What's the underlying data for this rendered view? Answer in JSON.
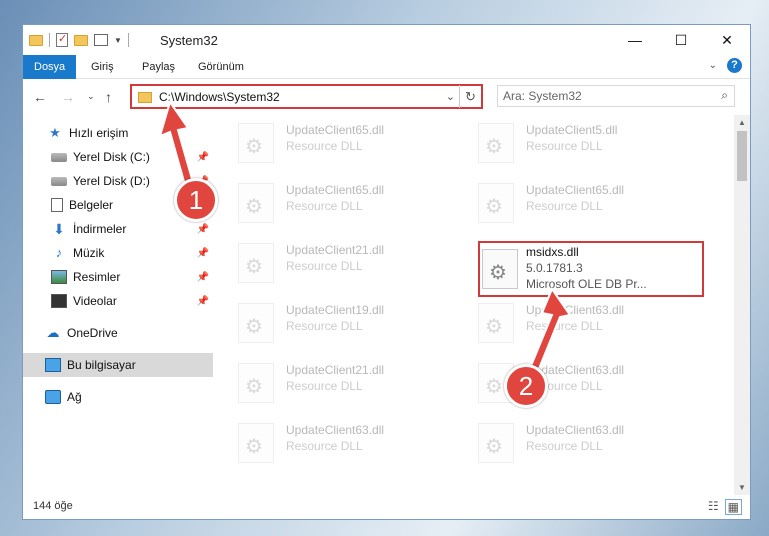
{
  "window": {
    "title": "System32"
  },
  "ribbon": {
    "tabs": [
      "Dosya",
      "Giriş",
      "Paylaş",
      "Görünüm"
    ]
  },
  "address": {
    "path": "C:\\Windows\\System32"
  },
  "search": {
    "placeholder": "Ara: System32"
  },
  "sidebar": {
    "items": [
      {
        "label": "Hızlı erişim",
        "icon": "star-icon"
      },
      {
        "label": "Yerel Disk (C:)",
        "icon": "drive-icon",
        "pinned": true
      },
      {
        "label": "Yerel Disk (D:)",
        "icon": "drive-icon",
        "pinned": true
      },
      {
        "label": "Belgeler",
        "icon": "document-icon",
        "pinned": true
      },
      {
        "label": "İndirmeler",
        "icon": "download-icon",
        "pinned": true
      },
      {
        "label": "Müzik",
        "icon": "music-icon",
        "pinned": true
      },
      {
        "label": "Resimler",
        "icon": "pictures-icon",
        "pinned": true
      },
      {
        "label": "Videolar",
        "icon": "video-icon",
        "pinned": true
      },
      {
        "label": "OneDrive",
        "icon": "cloud-icon"
      },
      {
        "label": "Bu bilgisayar",
        "icon": "computer-icon",
        "selected": true
      },
      {
        "label": "Ağ",
        "icon": "network-icon"
      }
    ]
  },
  "files": [
    {
      "name": "UpdateClient65.dll",
      "sub1": "Resource DLL",
      "sub2": ""
    },
    {
      "name": "UpdateClient5.dll",
      "sub1": "Resource DLL",
      "sub2": ""
    },
    {
      "name": "UpdateClient65.dll",
      "sub1": "Resource DLL",
      "sub2": ""
    },
    {
      "name": "UpdateClient65.dll",
      "sub1": "Resource DLL",
      "sub2": ""
    },
    {
      "name": "UpdateClient21.dll",
      "sub1": "Resource DLL",
      "sub2": ""
    },
    {
      "name": "msidxs.dll",
      "sub1": "5.0.1781.3",
      "sub2": "Microsoft OLE DB Pr..."
    },
    {
      "name": "UpdateClient19.dll",
      "sub1": "Resource DLL",
      "sub2": ""
    },
    {
      "name": "UpdateClient63.dll",
      "sub1": "Resource DLL",
      "sub2": ""
    },
    {
      "name": "UpdateClient21.dll",
      "sub1": "Resource DLL",
      "sub2": ""
    },
    {
      "name": "UpdateClient63.dll",
      "sub1": "Resource DLL",
      "sub2": ""
    },
    {
      "name": "UpdateClient63.dll",
      "sub1": "Resource DLL",
      "sub2": ""
    },
    {
      "name": "UpdateClient63.dll",
      "sub1": "Resource DLL",
      "sub2": ""
    }
  ],
  "status": {
    "count": "144 öğe"
  },
  "callouts": {
    "one": "1",
    "two": "2"
  },
  "colors": {
    "accent": "#1979ca",
    "highlight": "#d23a3a",
    "callout": "#e0453e"
  }
}
